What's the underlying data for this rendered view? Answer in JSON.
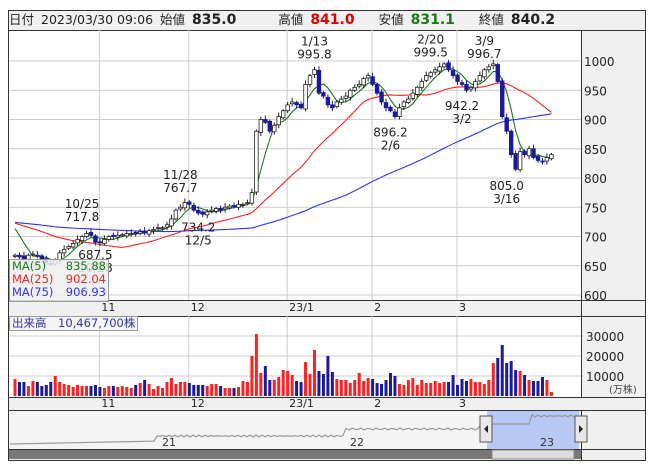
{
  "header": {
    "date_label": "日付",
    "datetime": "2023/03/30 09:06",
    "open_label": "始値",
    "open": "835.0",
    "high_label": "高値",
    "high": "841.0",
    "low_label": "安値",
    "low": "831.1",
    "close_label": "終値",
    "close": "840.2"
  },
  "ma_legend": [
    {
      "label": "MA(5)",
      "value": "835.88",
      "color": "#1a7a1a"
    },
    {
      "label": "MA(25)",
      "value": "902.04",
      "color": "#ff2020"
    },
    {
      "label": "MA(75)",
      "value": "906.93",
      "color": "#3030ff"
    }
  ],
  "volume_label": "出来高　10,467,700株",
  "volume_unit": "(万株)",
  "navigator": {
    "labels": [
      "21",
      "22",
      "23"
    ]
  },
  "chart_data": {
    "type": "candlestick",
    "price_axis": {
      "ticks": [
        "1000",
        "950",
        "900",
        "850",
        "800",
        "750",
        "700",
        "650",
        "600"
      ],
      "ylim": [
        600,
        1000
      ]
    },
    "volume_axis": {
      "ticks": [
        "30000",
        "20000",
        "10000"
      ]
    },
    "month_labels": [
      {
        "label": "11",
        "index": 20
      },
      {
        "label": "12",
        "index": 40
      },
      {
        "label": "23/1",
        "index": 62
      },
      {
        "label": "2",
        "index": 81
      },
      {
        "label": "3",
        "index": 100
      }
    ],
    "pre_period_avg": 725,
    "close": [
      668,
      665,
      662,
      668,
      670,
      667,
      660,
      655,
      652,
      660,
      672,
      678,
      683,
      688,
      695,
      700,
      705,
      702,
      690,
      690,
      695,
      700,
      700,
      702,
      703,
      705,
      705,
      706,
      708,
      706,
      710,
      712,
      715,
      715,
      720,
      730,
      745,
      750,
      758,
      755,
      745,
      740,
      738,
      742,
      745,
      748,
      745,
      750,
      752,
      752,
      755,
      755,
      758,
      775,
      880,
      900,
      895,
      880,
      890,
      905,
      915,
      925,
      930,
      925,
      920,
      960,
      975,
      985,
      945,
      940,
      925,
      920,
      930,
      935,
      940,
      950,
      955,
      960,
      970,
      975,
      960,
      945,
      930,
      920,
      915,
      905,
      920,
      930,
      935,
      945,
      955,
      965,
      975,
      980,
      985,
      990,
      995,
      985,
      975,
      965,
      960,
      950,
      955,
      965,
      975,
      985,
      990,
      995,
      965,
      905,
      880,
      840,
      815,
      845,
      840,
      850,
      835,
      830,
      828,
      835,
      840
    ],
    "volume": [
      8500,
      7000,
      7000,
      5000,
      7500,
      7000,
      5000,
      5500,
      7000,
      10000,
      7000,
      6000,
      5500,
      4500,
      5500,
      5000,
      5000,
      5000,
      5500,
      4500,
      4000,
      5000,
      5000,
      4500,
      5000,
      4500,
      4000,
      5500,
      6500,
      8000,
      6000,
      3500,
      5000,
      4000,
      7000,
      9000,
      6000,
      7000,
      7000,
      6500,
      5500,
      5500,
      5500,
      5000,
      6000,
      6000,
      5000,
      4000,
      4000,
      4000,
      4500,
      7500,
      7000,
      20000,
      31000,
      11500,
      15000,
      8000,
      8000,
      9500,
      13000,
      12500,
      10500,
      7500,
      7000,
      17000,
      11000,
      23000,
      12500,
      11000,
      20000,
      12000,
      8500,
      8000,
      8000,
      6500,
      8000,
      11500,
      7500,
      9000,
      8500,
      6500,
      6000,
      8000,
      11500,
      10000,
      6000,
      5500,
      8000,
      9000,
      5500,
      8000,
      6500,
      6500,
      7500,
      6500,
      7000,
      7000,
      10500,
      5500,
      8500,
      7500,
      8500,
      7000,
      7000,
      6000,
      8000,
      16500,
      19000,
      25500,
      16500,
      17500,
      13000,
      12500,
      10500,
      8000,
      7500,
      7500,
      9500,
      8000,
      2000
    ],
    "annotations": [
      {
        "index": 15,
        "price": 717.8,
        "date": "10/25",
        "value": "717.8",
        "pos": "above"
      },
      {
        "index": 18,
        "price": 687.5,
        "date": "10/28",
        "value": "687.5",
        "pos": "below"
      },
      {
        "index": 37,
        "price": 767.7,
        "date": "11/28",
        "value": "767.7",
        "pos": "above"
      },
      {
        "index": 41,
        "price": 734.2,
        "date": "12/5",
        "value": "734.2",
        "pos": "below"
      },
      {
        "index": 67,
        "price": 995.8,
        "date": "1/13",
        "value": "995.8",
        "pos": "above"
      },
      {
        "index": 84,
        "price": 896.2,
        "date": "2/6",
        "value": "896.2",
        "pos": "below"
      },
      {
        "index": 93,
        "price": 999.5,
        "date": "2/20",
        "value": "999.5",
        "pos": "above"
      },
      {
        "index": 100,
        "price": 942.2,
        "date": "3/2",
        "value": "942.2",
        "pos": "below"
      },
      {
        "index": 105,
        "price": 996.7,
        "date": "3/9",
        "value": "996.7",
        "pos": "above"
      },
      {
        "index": 110,
        "price": 805.0,
        "date": "3/16",
        "value": "805.0",
        "pos": "below"
      }
    ],
    "colors": {
      "up_candle": "#ffffff",
      "down_candle": "#1a1a9a",
      "vol_up": "#ff2020",
      "vol_down": "#1a1a9a"
    }
  }
}
